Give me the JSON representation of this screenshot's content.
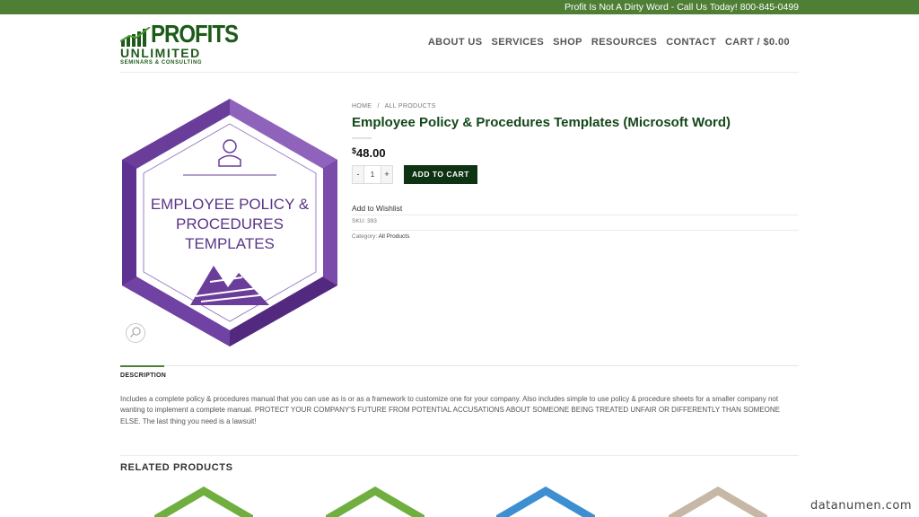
{
  "topbar": {
    "text": "Profit Is Not A Dirty Word - Call Us Today! 800-845-0499"
  },
  "logo": {
    "line1": "PROFITS",
    "line2": "UNLIMITED",
    "line3": "SEMINARS & CONSULTING"
  },
  "nav": {
    "items": [
      "ABOUT US",
      "SERVICES",
      "SHOP",
      "RESOURCES",
      "CONTACT",
      "CART / $0.00"
    ]
  },
  "product": {
    "image_lines": [
      "EMPLOYEE POLICY &",
      "PROCEDURES",
      "TEMPLATES"
    ],
    "breadcrumb": [
      "HOME",
      "/",
      "ALL PRODUCTS"
    ],
    "title": "Employee Policy & Procedures Templates (Microsoft Word)",
    "price_currency": "$",
    "price_amount": "48.00",
    "qty_minus": "-",
    "qty_value": "1",
    "qty_plus": "+",
    "add_to_cart": "ADD TO CART",
    "wishlist": "Add to Wishlist",
    "sku_label": "SKU: ",
    "sku_value": "393",
    "category_label": "Category: ",
    "category_value": "All Products"
  },
  "description": {
    "tab": "DESCRIPTION",
    "text": "Includes a complete policy & procedures manual that you can use as is or as a framework to customize one for your company. Also includes simple to use policy & procedure sheets for a smaller company not wanting to implement a complete manual. PROTECT YOUR COMPANY'S FUTURE FROM POTENTIAL ACCUSATIONS ABOUT SOMEONE BEING TREATED UNFAIR OR DIFFERENTLY THAN SOMEONE ELSE. The last thing you need is a lawsuit!"
  },
  "related": {
    "title": "RELATED PRODUCTS"
  },
  "watermark": "datanumen.com",
  "colors": {
    "topbar": "#4f7e35",
    "title": "#14471a",
    "button": "#0e3313",
    "hex_purple": "#6a3d9a",
    "related": [
      "#6fae3f",
      "#6fae3f",
      "#3d8fd1",
      "#c7b7a6"
    ]
  }
}
